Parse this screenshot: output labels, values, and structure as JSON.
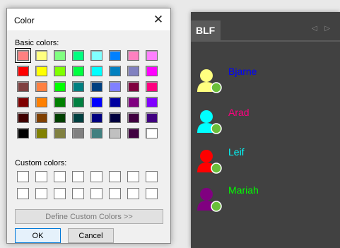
{
  "dialog": {
    "title": "Color",
    "close_glyph": "✕",
    "basic_colors_label": "Basic colors:",
    "custom_colors_label": "Custom colors:",
    "define_button_label": "Define Custom Colors >>",
    "ok_label": "OK",
    "cancel_label": "Cancel",
    "selected_basic_index": 0,
    "basic_colors": [
      "#ff8080",
      "#ffff80",
      "#80ff80",
      "#00ff80",
      "#80ffff",
      "#0080ff",
      "#ff80c0",
      "#ff80ff",
      "#ff0000",
      "#ffff00",
      "#80ff00",
      "#00ff40",
      "#00ffff",
      "#0080c0",
      "#8080c0",
      "#ff00ff",
      "#804040",
      "#ff8040",
      "#00ff00",
      "#008080",
      "#004080",
      "#8080ff",
      "#800040",
      "#ff0080",
      "#800000",
      "#ff8000",
      "#008000",
      "#008040",
      "#0000ff",
      "#0000a0",
      "#800080",
      "#8000ff",
      "#400000",
      "#804000",
      "#004000",
      "#004040",
      "#000080",
      "#000040",
      "#400040",
      "#400080",
      "#000000",
      "#808000",
      "#808040",
      "#808080",
      "#408080",
      "#c0c0c0",
      "#400040",
      "#ffffff"
    ],
    "custom_colors": [
      "#ffffff",
      "#ffffff",
      "#ffffff",
      "#ffffff",
      "#ffffff",
      "#ffffff",
      "#ffffff",
      "#ffffff",
      "#ffffff",
      "#ffffff",
      "#ffffff",
      "#ffffff",
      "#ffffff",
      "#ffffff",
      "#ffffff",
      "#ffffff"
    ]
  },
  "panel": {
    "tab_label": "BLF",
    "tab_arrows": "◁ ▷",
    "status_color": "#6abf3a",
    "contacts": [
      {
        "name": "Bjarne",
        "text_color": "#0000ff",
        "avatar_color": "#ffff80",
        "icon": "user-icon"
      },
      {
        "name": "Arad",
        "text_color": "#ff0080",
        "avatar_color": "#00ffff",
        "icon": "user-icon"
      },
      {
        "name": "Leif",
        "text_color": "#00ffff",
        "avatar_color": "#ff0000",
        "icon": "user-icon"
      },
      {
        "name": "Mariah",
        "text_color": "#00ff00",
        "avatar_color": "#800080",
        "icon": "user-icon"
      }
    ]
  }
}
